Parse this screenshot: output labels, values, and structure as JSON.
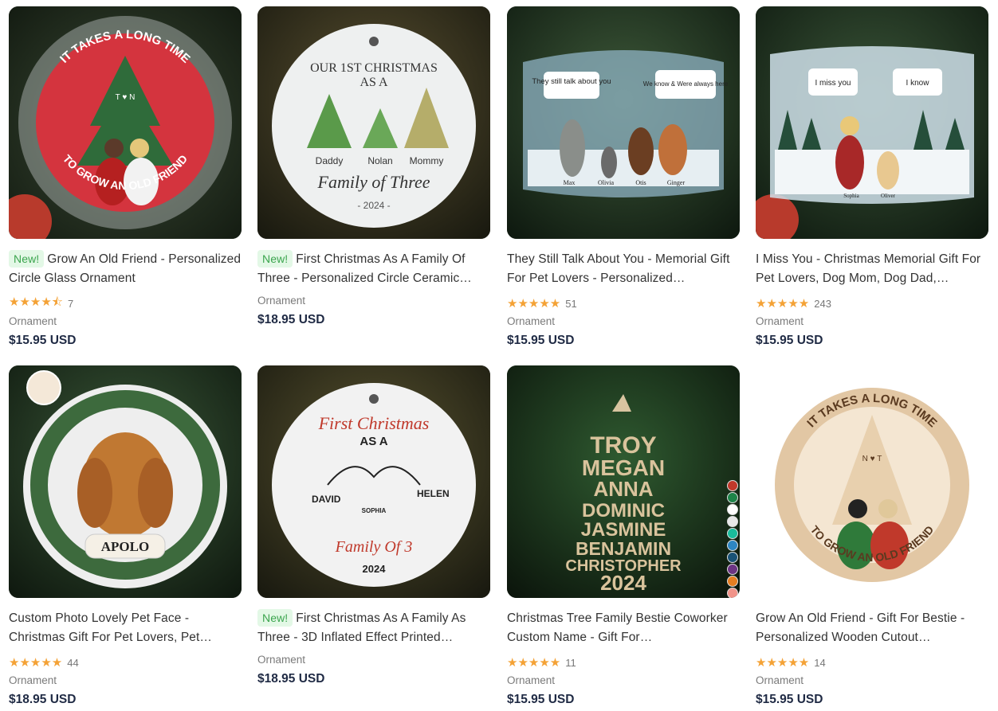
{
  "products": [
    {
      "new": "New!",
      "title": "Grow An Old Friend - Personalized Circle Glass Ornament",
      "stars": "★★★★⯪",
      "count": "7",
      "type": "Ornament",
      "price": "$15.95 USD",
      "art_top": "IT TAKES A LONG TIME",
      "art_bottom": "TO GROW AN OLD FRIEND",
      "art_initials": "T ♥ N"
    },
    {
      "new": "New!",
      "title": "First Christmas As A Family Of Three - Personalized Circle Ceramic…",
      "stars": "",
      "count": "",
      "type": "Ornament",
      "price": "$18.95 USD",
      "art_title1": "OUR 1ST CHRISTMAS",
      "art_title2": "AS A",
      "art_names": [
        "Daddy",
        "Nolan",
        "Mommy"
      ],
      "art_script": "Family of Three",
      "art_year": "- 2024 -"
    },
    {
      "new": "",
      "title": "They Still Talk About You - Memorial Gift For Pet Lovers - Personalized…",
      "stars": "★★★★★",
      "count": "51",
      "type": "Ornament",
      "price": "$15.95 USD",
      "art_bubble1": "They still talk about you",
      "art_bubble2": "We know & Were always here",
      "art_names": [
        "Max",
        "Olivia",
        "Otis",
        "Ginger"
      ]
    },
    {
      "new": "",
      "title": "I Miss You - Christmas Memorial Gift For Pet Lovers, Dog Mom, Dog Dad,…",
      "stars": "★★★★★",
      "count": "243",
      "type": "Ornament",
      "price": "$15.95 USD",
      "art_bubble1": "I miss you",
      "art_bubble2": "I know",
      "art_names": [
        "Sophia",
        "Oliver"
      ]
    },
    {
      "new": "",
      "title": "Custom Photo Lovely Pet Face - Christmas Gift For Pet Lovers, Pet…",
      "stars": "★★★★★",
      "count": "44",
      "type": "Ornament",
      "price": "$18.95 USD",
      "art_name": "APOLO"
    },
    {
      "new": "New!",
      "title": "First Christmas As A Family As Three - 3D Inflated Effect Printed…",
      "stars": "",
      "count": "",
      "type": "Ornament",
      "price": "$18.95 USD",
      "art_title1": "First Christmas",
      "art_title2": "AS A",
      "art_names": [
        "DAVID",
        "SOPHIA",
        "HELEN"
      ],
      "art_script": "Family Of 3",
      "art_year": "2024"
    },
    {
      "new": "",
      "title": "Christmas Tree Family Bestie Coworker Custom Name - Gift For…",
      "stars": "★★★★★",
      "count": "11",
      "type": "Ornament",
      "price": "$15.95 USD",
      "art_names": [
        "TROY",
        "MEGAN",
        "ANNA",
        "DOMINIC",
        "JASMINE",
        "BENJAMIN",
        "CHRISTOPHER",
        "2024"
      ]
    },
    {
      "new": "",
      "title": "Grow An Old Friend - Gift For Bestie - Personalized Wooden Cutout…",
      "stars": "★★★★★",
      "count": "14",
      "type": "Ornament",
      "price": "$15.95 USD",
      "art_top": "IT TAKES A LONG TIME",
      "art_bottom": "TO GROW AN OLD FRIEND",
      "art_initials": "N ♥ T"
    }
  ],
  "colors": {
    "accent": "#f4a236",
    "price": "#1f2a44",
    "badge_bg": "#e3f8e6",
    "badge_fg": "#3ba54e"
  },
  "swatch_colors": [
    "#c0392b",
    "#1e8449",
    "#ffffff",
    "#e8e8e8",
    "#1abc9c",
    "#2e86c1",
    "#1a5276",
    "#6c3483",
    "#e67e22",
    "#f1948a",
    "#a04000",
    "#d5c8a0",
    "#555555"
  ]
}
